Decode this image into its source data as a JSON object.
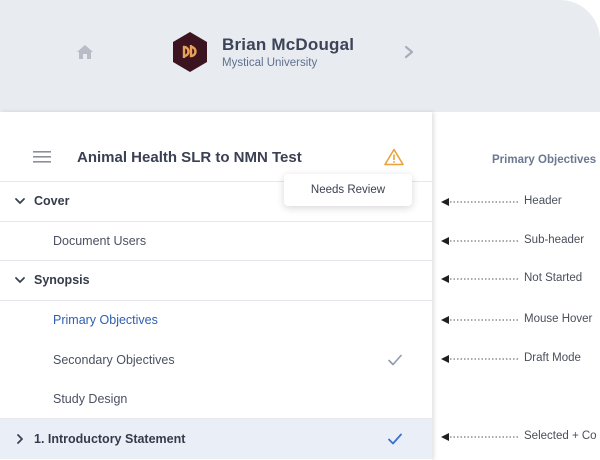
{
  "header": {
    "user_name": "Brian McDougal",
    "organization": "Mystical University",
    "home_icon": "home-icon",
    "next_icon": "chevron-right-icon",
    "logo_bg": "#3b1420",
    "logo_fg": "#e8a15a"
  },
  "document": {
    "title": "Animal Health SLR to NMN Test",
    "status_icon": "warning-icon",
    "status_color": "#e8a33a",
    "tooltip": "Needs Review"
  },
  "outline": [
    {
      "type": "section",
      "label": "Cover",
      "expanded": true
    },
    {
      "type": "item",
      "label": "Document Users",
      "state": "normal"
    },
    {
      "type": "section",
      "label": "Synopsis",
      "expanded": true
    },
    {
      "type": "item",
      "label": "Primary Objectives",
      "state": "hover"
    },
    {
      "type": "item",
      "label": "Secondary Objectives",
      "state": "draft",
      "check": true
    },
    {
      "type": "item",
      "label": "Study Design",
      "state": "normal"
    },
    {
      "type": "section",
      "label": "1. Introductory Statement",
      "expanded": false,
      "selected": true,
      "check": true
    }
  ],
  "legend": {
    "heading": "Primary Objectives",
    "items": [
      "Header",
      "Sub-header",
      "Not Started",
      "Mouse Hover",
      "Draft Mode",
      "Selected + Co"
    ]
  },
  "colors": {
    "accent_blue": "#2f5fae",
    "check_gray": "#8f99ad",
    "check_blue": "#3d6fcf",
    "selected_bg": "#e9eef7",
    "header_bg": "#e8ebf0"
  }
}
